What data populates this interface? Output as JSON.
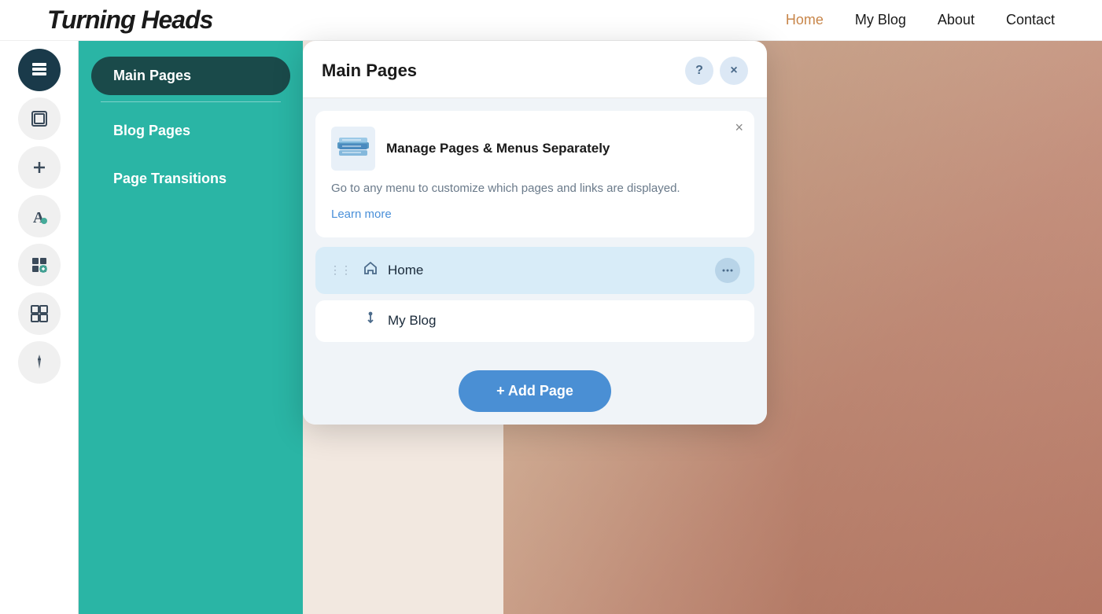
{
  "website": {
    "logo": "Turning Heads",
    "nav": {
      "items": [
        {
          "label": "Home",
          "active": true
        },
        {
          "label": "My Blog",
          "active": false
        },
        {
          "label": "About",
          "active": false
        },
        {
          "label": "Contact",
          "active": false
        }
      ]
    }
  },
  "sidebar": {
    "icons": [
      {
        "name": "pages-icon",
        "symbol": "≡",
        "active": true
      },
      {
        "name": "layers-icon",
        "symbol": "▣",
        "active": false
      },
      {
        "name": "add-icon",
        "symbol": "+",
        "active": false
      },
      {
        "name": "text-icon",
        "symbol": "A",
        "active": false
      },
      {
        "name": "apps-icon",
        "symbol": "⊞",
        "active": false
      },
      {
        "name": "media-icon",
        "symbol": "⊡",
        "active": false
      },
      {
        "name": "pen-icon",
        "symbol": "✒",
        "active": false
      }
    ]
  },
  "pages_panel": {
    "items": [
      {
        "label": "Main Pages",
        "active": true
      },
      {
        "label": "Blog Pages",
        "active": false
      },
      {
        "label": "Page Transitions",
        "active": false
      }
    ]
  },
  "dialog": {
    "title": "Main Pages",
    "help_button_label": "?",
    "close_button_label": "×",
    "info_card": {
      "title": "Manage Pages & Menus Separately",
      "body": "Go to any menu to customize which pages and links are displayed.",
      "learn_more": "Learn more",
      "close_label": "×"
    },
    "pages": [
      {
        "name": "Home",
        "selected": true
      },
      {
        "name": "My Blog",
        "selected": false
      }
    ],
    "add_page_label": "+ Add Page"
  }
}
